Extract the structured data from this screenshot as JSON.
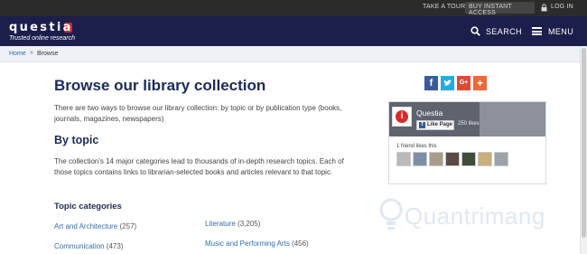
{
  "topbar": {
    "take_tour": "TAKE A TOUR",
    "buy_access": "BUY INSTANT ACCESS",
    "log_in": "LOG IN"
  },
  "nav": {
    "logo_word": "questia",
    "logo_tagline": "Trusted online research",
    "search_label": "SEARCH",
    "menu_label": "MENU"
  },
  "breadcrumb": {
    "home": "Home",
    "separator": "»",
    "current": "Browse"
  },
  "main": {
    "title": "Browse our library collection",
    "intro": "There are two ways to browse our library collection: by topic or by publication type (books, journals, magazines, newspapers)",
    "by_topic_heading": "By topic",
    "topic_description": "The collection's 14 major categories lead to thousands of in-depth research topics. Each of those topics contains links to librarian-selected books and articles relevant to that topic.",
    "categories_heading": "Topic categories",
    "categories": [
      {
        "name": "Art and Architecture",
        "count": "(257)"
      },
      {
        "name": "Literature",
        "count": "(3,205)"
      },
      {
        "name": "Communication",
        "count": "(473)"
      },
      {
        "name": "Music and Performing Arts",
        "count": "(456)"
      }
    ]
  },
  "share": {
    "facebook": "f",
    "google_plus": "G+",
    "more": "+"
  },
  "facebook_widget": {
    "page_name": "Questia",
    "like_button": "Like Page",
    "likes_count": "250 likes",
    "friend_likes": "1 friend likes this"
  },
  "watermark": {
    "text": "Quantrimang"
  },
  "colors": {
    "navbar": "#1c1f4c",
    "topbar": "#2b2b2b",
    "link": "#2f6fae",
    "heading": "#1c2a55",
    "logo_accent": "#d62b27"
  }
}
